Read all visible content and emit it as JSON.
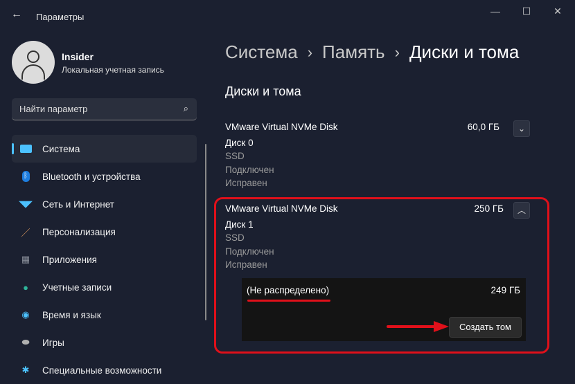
{
  "window": {
    "title": "Параметры"
  },
  "user": {
    "name": "Insider",
    "account": "Локальная учетная запись"
  },
  "search": {
    "placeholder": "Найти параметр"
  },
  "nav": [
    {
      "label": "Система",
      "icon": "monitor-icon",
      "color": "#4cc2ff"
    },
    {
      "label": "Bluetooth и устройства",
      "icon": "bluetooth-icon",
      "color": "#1e7ee0"
    },
    {
      "label": "Сеть и Интернет",
      "icon": "wifi-icon",
      "color": "#4cc2ff"
    },
    {
      "label": "Персонализация",
      "icon": "brush-icon",
      "color": "#e8a060"
    },
    {
      "label": "Приложения",
      "icon": "apps-icon",
      "color": "#8a8f9a"
    },
    {
      "label": "Учетные записи",
      "icon": "person-icon",
      "color": "#2fb49a"
    },
    {
      "label": "Время и язык",
      "icon": "clock-globe-icon",
      "color": "#4cc2ff"
    },
    {
      "label": "Игры",
      "icon": "gamepad-icon",
      "color": "#b0b0b0"
    },
    {
      "label": "Специальные возможности",
      "icon": "accessibility-icon",
      "color": "#4cc2ff"
    }
  ],
  "breadcrumb": [
    "Система",
    "Память",
    "Диски и тома"
  ],
  "section_title": "Диски и тома",
  "disks": [
    {
      "model": "VMware Virtual NVMe Disk",
      "size": "60,0 ГБ",
      "name": "Диск 0",
      "type": "SSD",
      "status": "Подключен",
      "health": "Исправен",
      "expanded": false
    },
    {
      "model": "VMware Virtual NVMe Disk",
      "size": "250 ГБ",
      "name": "Диск 1",
      "type": "SSD",
      "status": "Подключен",
      "health": "Исправен",
      "expanded": true,
      "partition": {
        "name": "(Не распределено)",
        "size": "249 ГБ",
        "action": "Создать том"
      }
    }
  ]
}
